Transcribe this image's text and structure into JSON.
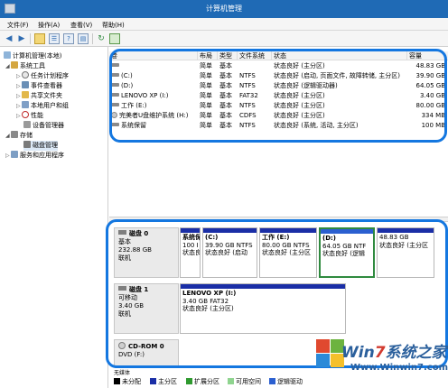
{
  "window": {
    "title": "计算机管理"
  },
  "menu": [
    "文件(F)",
    "操作(A)",
    "查看(V)",
    "帮助(H)"
  ],
  "toolbar": {
    "icons": [
      "back-arrow-icon",
      "forward-arrow-icon",
      "folder-up-icon",
      "list-view-icon",
      "help-icon",
      "properties-icon",
      "refresh-icon",
      "export-icon"
    ]
  },
  "tree": {
    "root": "计算机管理(本地)",
    "system_tools": "系统工具",
    "task_scheduler": "任务计划程序",
    "event_viewer": "事件查看器",
    "shared_folders": "共享文件夹",
    "local_users": "本地用户和组",
    "performance": "性能",
    "device_manager": "设备管理器",
    "storage": "存储",
    "disk_management": "磁盘管理",
    "services": "服务和应用程序"
  },
  "volumes": {
    "headers": {
      "volume": "卷",
      "layout": "布局",
      "type": "类型",
      "fs": "文件系统",
      "status": "状态",
      "capacity": "容量"
    },
    "rows": [
      {
        "name": "",
        "layout": "简单",
        "type": "基本",
        "fs": "",
        "status": "状态良好 (主分区)",
        "capacity": "48.83 GB"
      },
      {
        "name": "(C:)",
        "layout": "简单",
        "type": "基本",
        "fs": "NTFS",
        "status": "状态良好 (启动, 页面文件, 故障转储, 主分区)",
        "capacity": "39.90 GB"
      },
      {
        "name": "(D:)",
        "layout": "简单",
        "type": "基本",
        "fs": "NTFS",
        "status": "状态良好 (逻辑驱动器)",
        "capacity": "64.05 GB"
      },
      {
        "name": "LENOVO XP (I:)",
        "layout": "简单",
        "type": "基本",
        "fs": "FAT32",
        "status": "状态良好 (主分区)",
        "capacity": "3.40 GB"
      },
      {
        "name": "工作 (E:)",
        "layout": "简单",
        "type": "基本",
        "fs": "NTFS",
        "status": "状态良好 (主分区)",
        "capacity": "80.00 GB"
      },
      {
        "name": "完美者U盘维护系统 (H:)",
        "layout": "简单",
        "type": "基本",
        "fs": "CDFS",
        "status": "状态良好 (主分区)",
        "capacity": "334 MB"
      },
      {
        "name": "系统保留",
        "layout": "简单",
        "type": "基本",
        "fs": "NTFS",
        "status": "状态良好 (系统, 活动, 主分区)",
        "capacity": "100 MB"
      }
    ]
  },
  "disks": {
    "disk0": {
      "name": "磁盘 0",
      "kind": "基本",
      "size": "232.88 GB",
      "state": "联机",
      "parts": [
        {
          "name": "系统保",
          "size": "100 I",
          "status": "状态良"
        },
        {
          "name": "(C:)",
          "size": "39.90 GB NTFS",
          "status": "状态良好 (启动"
        },
        {
          "name": "工作 (E:)",
          "size": "80.00 GB NTFS",
          "status": "状态良好 (主分区"
        },
        {
          "name": "(D:)",
          "size": "64.05 GB NTF",
          "status": "状态良好 (逻辑"
        },
        {
          "name": "",
          "size": "48.83 GB",
          "status": "状态良好 (主分区"
        }
      ]
    },
    "disk1": {
      "name": "磁盘 1",
      "kind": "可移动",
      "size": "3.40 GB",
      "state": "联机",
      "parts": [
        {
          "name": "LENOVO XP (I:)",
          "size": "3.40 GB FAT32",
          "status": "状态良好 (主分区)"
        }
      ]
    },
    "cdrom0": {
      "name": "CD-ROM 0",
      "kind": "DVD (F:)"
    }
  },
  "legend": {
    "truncated": "无媒体",
    "items": [
      {
        "label": "未分配",
        "color": "#000000"
      },
      {
        "label": "主分区",
        "color": "#1a2ea6"
      },
      {
        "label": "扩展分区",
        "color": "#2f9a2f"
      },
      {
        "label": "可用空间",
        "color": "#8fd48f"
      },
      {
        "label": "逻辑驱动",
        "color": "#2b5fd0"
      }
    ]
  },
  "watermark": {
    "brand_a": "Win",
    "brand_b": "7",
    "brand_c": "系统之家",
    "url": "Www.Winwin7.com"
  }
}
